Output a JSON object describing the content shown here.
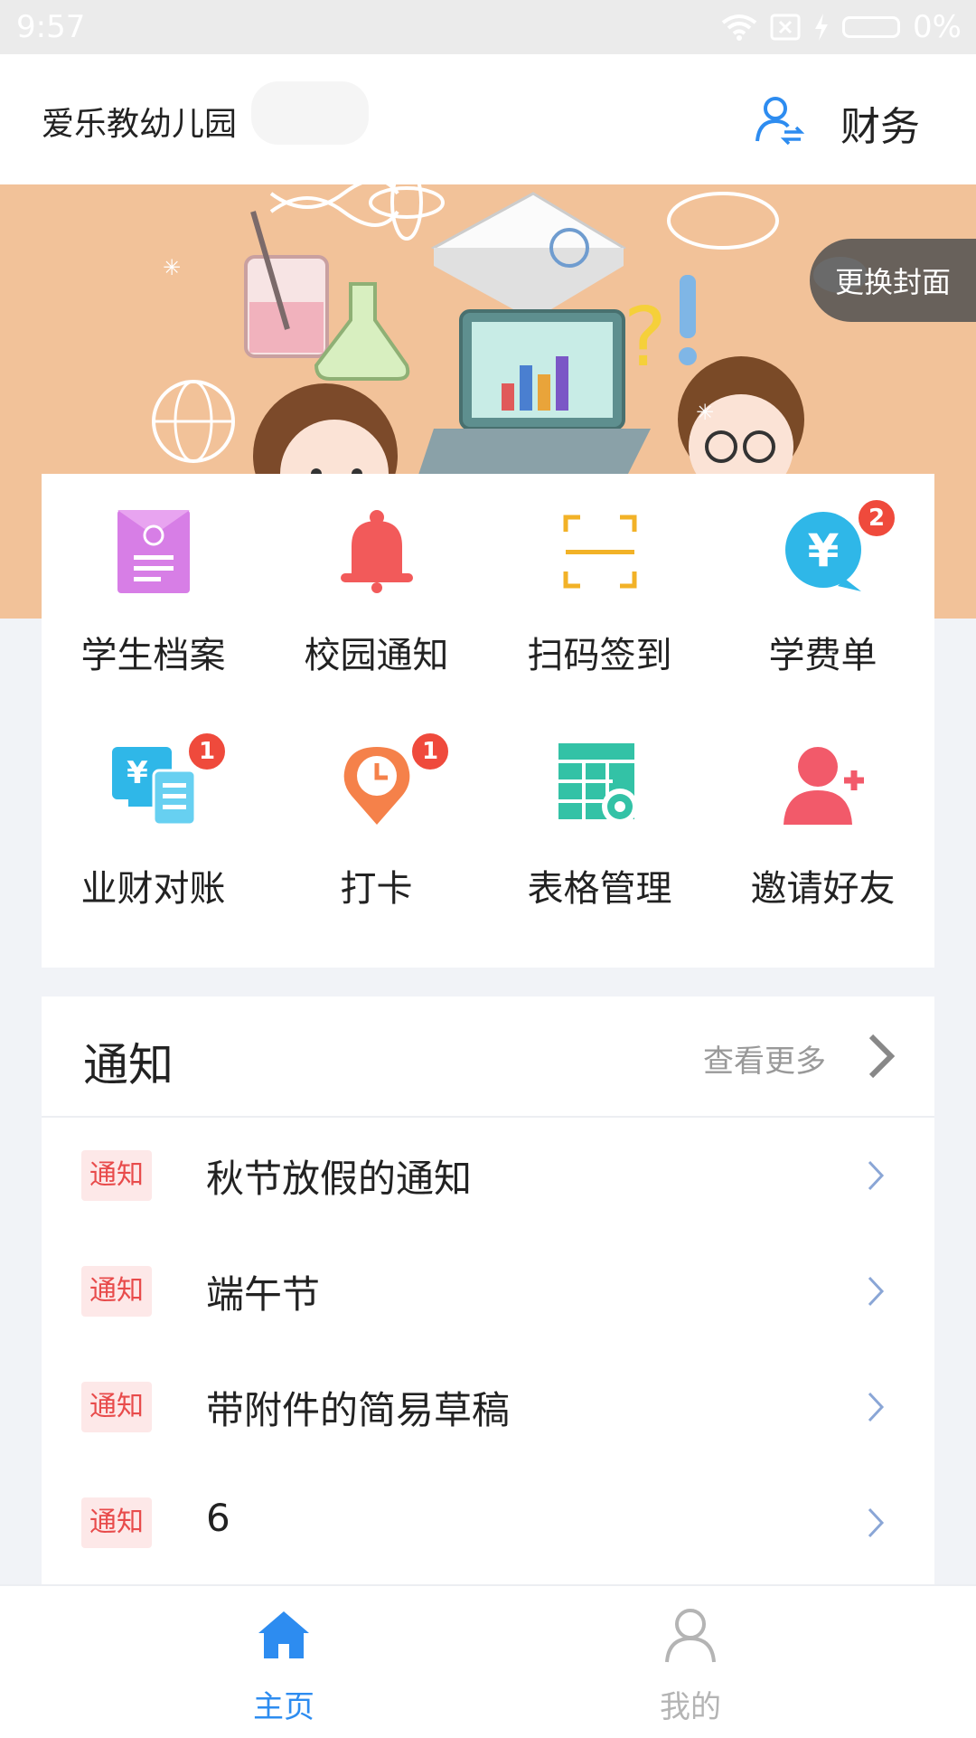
{
  "status_bar": {
    "time": "9:57",
    "battery": "0%"
  },
  "header": {
    "school_name": "爱乐教幼儿园",
    "role_label": "财务"
  },
  "banner": {
    "change_cover_label": "更换封面"
  },
  "grid": [
    {
      "label": "学生档案"
    },
    {
      "label": "校园通知"
    },
    {
      "label": "扫码签到"
    },
    {
      "label": "学费单",
      "badge": "2"
    },
    {
      "label": "业财对账",
      "badge": "1"
    },
    {
      "label": "打卡",
      "badge": "1"
    },
    {
      "label": "表格管理"
    },
    {
      "label": "邀请好友"
    }
  ],
  "notice": {
    "title": "通知",
    "more_label": "查看更多",
    "items": [
      {
        "tag": "通知",
        "title": "秋节放假的通知"
      },
      {
        "tag": "通知",
        "title": "端午节"
      },
      {
        "tag": "通知",
        "title": "带附件的简易草稿"
      },
      {
        "tag": "通知",
        "title": "6"
      }
    ]
  },
  "tabbar": {
    "home_label": "主页",
    "mine_label": "我的",
    "active_color": "#2d8cf0",
    "inactive_color": "#b4b4b4"
  }
}
